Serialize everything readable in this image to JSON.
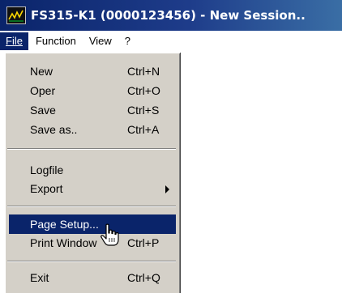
{
  "window": {
    "title": "FS315-K1 (0000123456) - New Session..",
    "app_icon": "graph-icon"
  },
  "menubar": {
    "items": [
      "File",
      "Function",
      "View",
      "?"
    ]
  },
  "file_menu": {
    "items": [
      {
        "label": "New",
        "shortcut": "Ctrl+N"
      },
      {
        "label": "Oper",
        "shortcut": "Ctrl+O"
      },
      {
        "label": "Save",
        "shortcut": "Ctrl+S"
      },
      {
        "label": "Save as..",
        "shortcut": "Ctrl+A"
      },
      {
        "label": "Logfile",
        "shortcut": ""
      },
      {
        "label": "Export",
        "shortcut": ""
      },
      {
        "label": "Page Setup...",
        "shortcut": ""
      },
      {
        "label": "Print Window",
        "shortcut": "Ctrl+P"
      },
      {
        "label": "Exit",
        "shortcut": "Ctrl+Q"
      }
    ],
    "highlighted_item": "Page Setup...",
    "export_has_submenu": true
  },
  "cursor": {
    "icon": "hand-pointer-icon"
  },
  "colors": {
    "title_bar": "#0a246a",
    "highlight": "#0a246a",
    "menu_background": "#d4d0c8"
  }
}
